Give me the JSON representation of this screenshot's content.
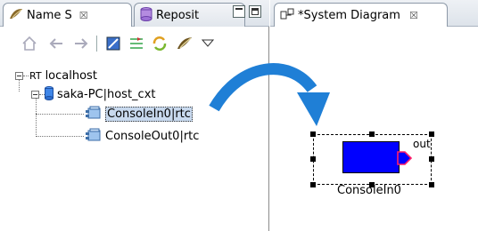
{
  "left_view": {
    "tabs": [
      {
        "label": "Name S",
        "close": "☒"
      },
      {
        "label": "Reposit"
      }
    ]
  },
  "tree": {
    "root": {
      "prefix": "RT",
      "label": "localhost"
    },
    "host": {
      "label": "saka-PC|host_cxt"
    },
    "components": [
      {
        "label": "ConsoleIn0|rtc",
        "selected": true
      },
      {
        "label": "ConsoleOut0|rtc",
        "selected": false
      }
    ]
  },
  "right_view": {
    "tab": {
      "label": "*System Diagram",
      "close": "☒"
    }
  },
  "diagram": {
    "component_label": "ConsoleIn0",
    "port_label": "out",
    "arrow_color": "#1f7fd6",
    "component_color": "#0000ff"
  }
}
